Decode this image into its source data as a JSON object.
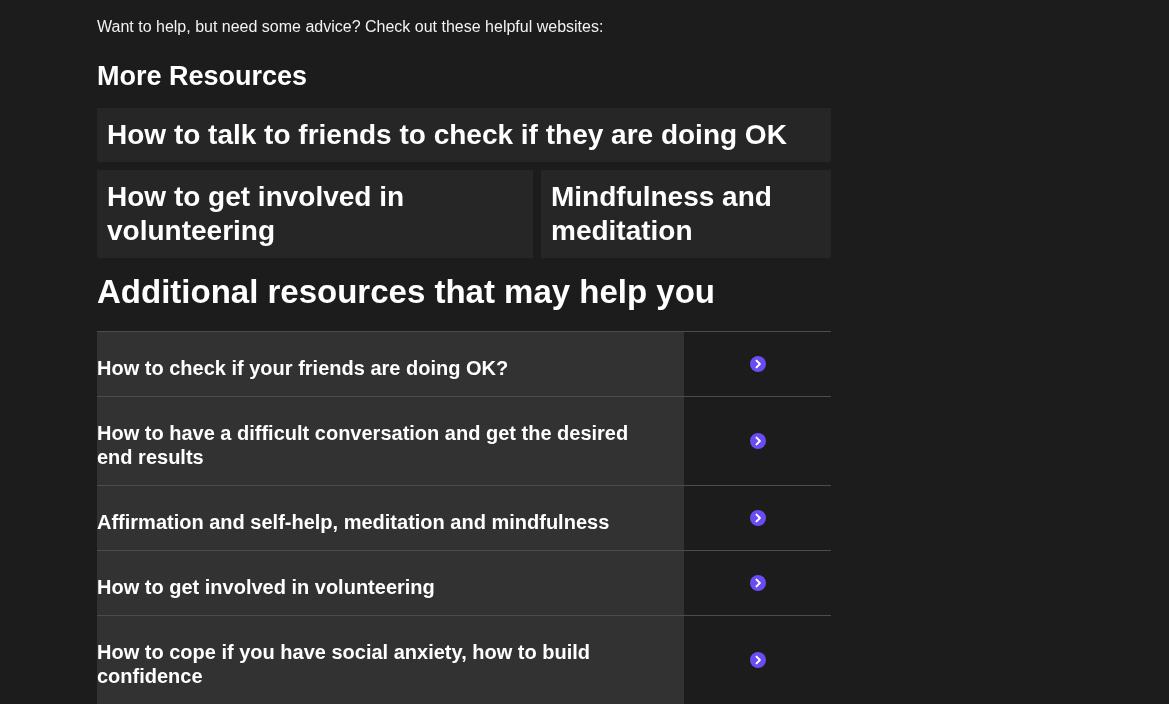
{
  "intro": "Want to help, but need some advice? Check out these helpful websites:",
  "more_resources": {
    "heading": "More Resources",
    "cards": [
      {
        "title": "How to talk to friends to check if they are doing OK"
      },
      {
        "title": "How to get involved in volunteering"
      },
      {
        "title": "Mindfulness and meditation"
      }
    ]
  },
  "additional_resources": {
    "heading": "Additional resources that may help you",
    "rows": [
      {
        "title": "How to check if your friends are doing OK?"
      },
      {
        "title": "How to have a difficult conversation and get the desired end results"
      },
      {
        "title": "Affirmation and self-help, meditation and mindfulness"
      },
      {
        "title": "How to get involved in volunteering"
      },
      {
        "title": "How to cope if you have social anxiety, how to build confidence"
      }
    ]
  }
}
